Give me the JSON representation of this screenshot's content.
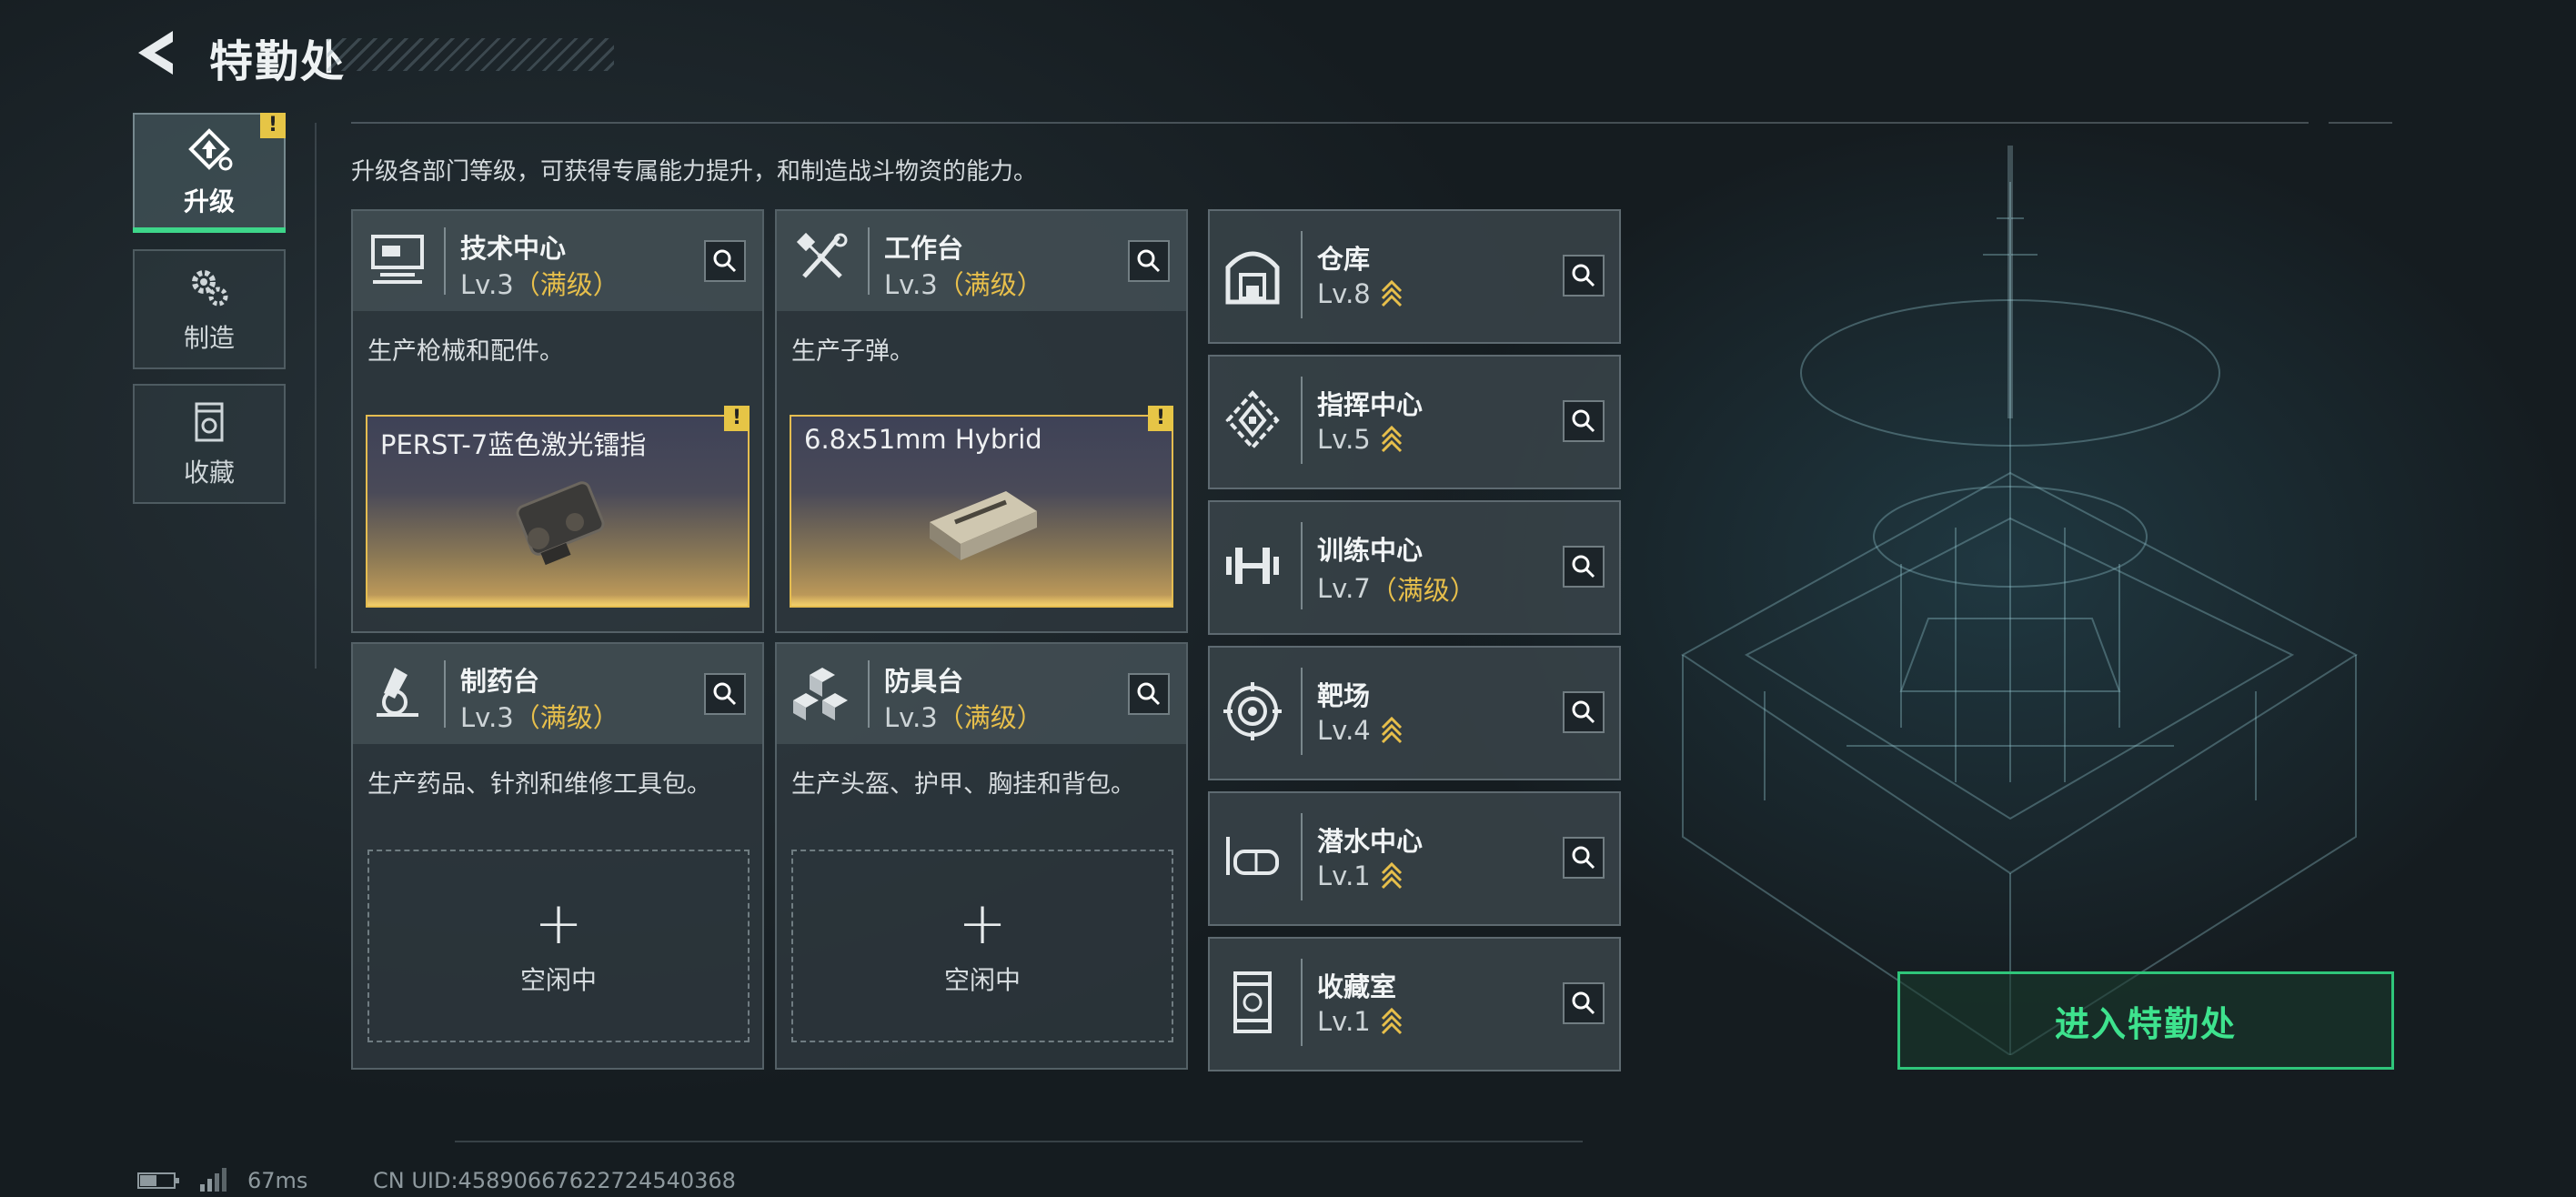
{
  "header": {
    "title": "特勤处"
  },
  "description": "升级各部门等级，可获得专属能力提升，和制造战斗物资的能力。",
  "tabs": [
    {
      "label": "升级",
      "icon": "upgrade-icon",
      "active": true,
      "alert": "!"
    },
    {
      "label": "制造",
      "icon": "gears-icon",
      "active": false
    },
    {
      "label": "收藏",
      "icon": "collection-icon",
      "active": false
    }
  ],
  "departments": [
    {
      "name": "技术中心",
      "level": "Lv.3",
      "max_label": "（满级）",
      "desc": "生产枪械和配件。",
      "icon": "tech-center-icon",
      "production": {
        "item": "PERST-7蓝色激光镭指",
        "alert": "!"
      }
    },
    {
      "name": "工作台",
      "level": "Lv.3",
      "max_label": "（满级）",
      "desc": "生产子弹。",
      "icon": "workbench-icon",
      "production": {
        "item": "6.8x51mm Hybrid",
        "alert": "!"
      }
    },
    {
      "name": "制药台",
      "level": "Lv.3",
      "max_label": "（满级）",
      "desc": "生产药品、针剂和维修工具包。",
      "icon": "pharmacy-icon",
      "idle": {
        "plus": "+",
        "label": "空闲中"
      }
    },
    {
      "name": "防具台",
      "level": "Lv.3",
      "max_label": "（满级）",
      "desc": "生产头盔、护甲、胸挂和背包。",
      "icon": "armor-bench-icon",
      "idle": {
        "plus": "+",
        "label": "空闲中"
      }
    }
  ],
  "facilities": [
    {
      "name": "仓库",
      "level": "Lv.8",
      "icon": "warehouse-icon",
      "upgradable": true
    },
    {
      "name": "指挥中心",
      "level": "Lv.5",
      "icon": "command-center-icon",
      "upgradable": true
    },
    {
      "name": "训练中心",
      "level": "Lv.7",
      "max_label": "（满级）",
      "icon": "training-center-icon",
      "upgradable": false
    },
    {
      "name": "靶场",
      "level": "Lv.4",
      "icon": "shooting-range-icon",
      "upgradable": true
    },
    {
      "name": "潜水中心",
      "level": "Lv.1",
      "icon": "diving-center-icon",
      "upgradable": true
    },
    {
      "name": "收藏室",
      "level": "Lv.1",
      "icon": "collection-room-icon",
      "upgradable": true
    }
  ],
  "enter_button": "进入特勤处",
  "footer": {
    "ping": "67ms",
    "uid": "CN UID:4589066762272454036​8"
  },
  "colors": {
    "accent": "#3ee38e",
    "max_level": "#e7bf4b",
    "alert": "#e6c546"
  }
}
